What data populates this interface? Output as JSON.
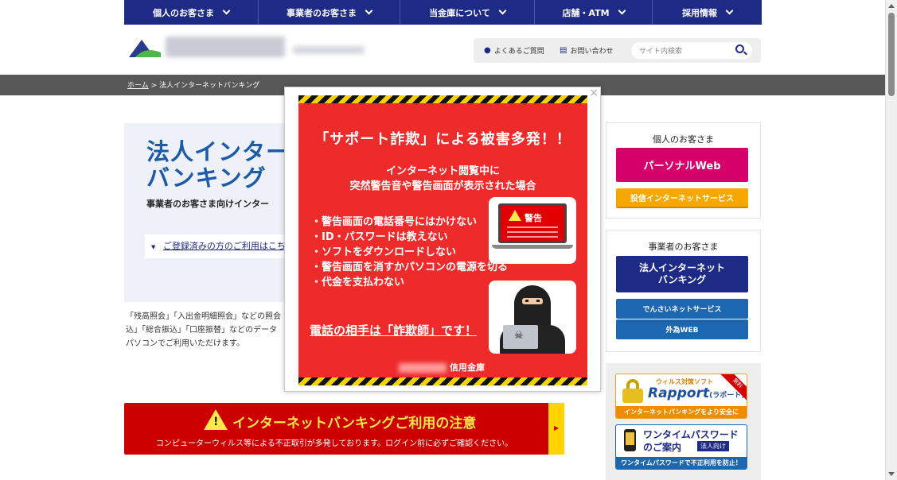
{
  "nav": {
    "items": [
      {
        "label": "個人のお客さま"
      },
      {
        "label": "事業者のお客さま"
      },
      {
        "label": "当金庫について"
      },
      {
        "label": "店舗・ATM"
      },
      {
        "label": "採用情報"
      }
    ]
  },
  "header": {
    "faq_label": "よくあるご質問",
    "contact_label": "お問い合わせ",
    "search_placeholder": "サイト内検索"
  },
  "breadcrumb": {
    "home": "ホーム",
    "separator": ">",
    "current": "法人インターネットバンキング"
  },
  "hero": {
    "title_line1": "法人インター",
    "title_line2": "バンキング",
    "subtitle": "事業者のお客さま向けインター",
    "login_link": "ご登録済みの方のご利用はこちら"
  },
  "body": {
    "line1": "「残高照会」「入出金明細照会」などの照会",
    "line2": "込」「総合振込」「口座振替」などのデータ",
    "line3": "パソコンでご利用いただけます。"
  },
  "caution": {
    "title": "インターネットバンキングご利用の注意",
    "description": "コンピューターウィルス等による不正取引が多発しております。ログイン前に必ずご確認ください。"
  },
  "sidebar": {
    "personal": {
      "heading": "個人のお客さま",
      "primary_button": "パーソナルWeb",
      "secondary_button": "投信インターネットサービス"
    },
    "business": {
      "heading": "事業者のお客さま",
      "primary_line1": "法人インターネット",
      "primary_line2": "バンキング",
      "densai_button": "でんさいネットサービス",
      "gaitame_button": "外為WEB"
    },
    "ads": {
      "rapport_small": "ウィルス対策ソフト",
      "rapport_big": "Rapport",
      "rapport_kana": "(ラポート)",
      "rapport_free": "無料",
      "rapport_foot": "インターネットバンキングをより安全に",
      "onetime_line1": "ワンタイムパスワード",
      "onetime_line2": "のご案内",
      "onetime_tag": "法人向け",
      "onetime_foot": "ワンタイムパスワードで不正利用を防止！"
    }
  },
  "modal": {
    "close": "×",
    "headline": "「サポート詐欺」による被害多発！！",
    "sub1": "インターネット閲覧中に",
    "sub2": "突然警告音や警告画面が表示された場合",
    "bullets": [
      "・警告画面の電話番号にはかけない",
      "・ID・パスワードは教えない",
      "・ソフトをダウンロードしない",
      "・警告画面を消すかパソコンの電源を切る",
      "・代金を支払わない"
    ],
    "warning_label": "警告",
    "scam_line": "電話の相手は「詐欺師」です！",
    "footer": "信用金庫"
  },
  "colors": {
    "navy": "#1d2a86",
    "magenta": "#d6006b",
    "orange": "#f6a800",
    "poster_red": "#ee2b2b",
    "caution_red": "#cc0000"
  },
  "icons": {
    "nav_chevron": "chevron-down-icon",
    "faq": "chat-bubbles-icon",
    "contact": "document-icon",
    "search": "search-icon",
    "close": "close-icon",
    "warning": "warning-icon"
  }
}
